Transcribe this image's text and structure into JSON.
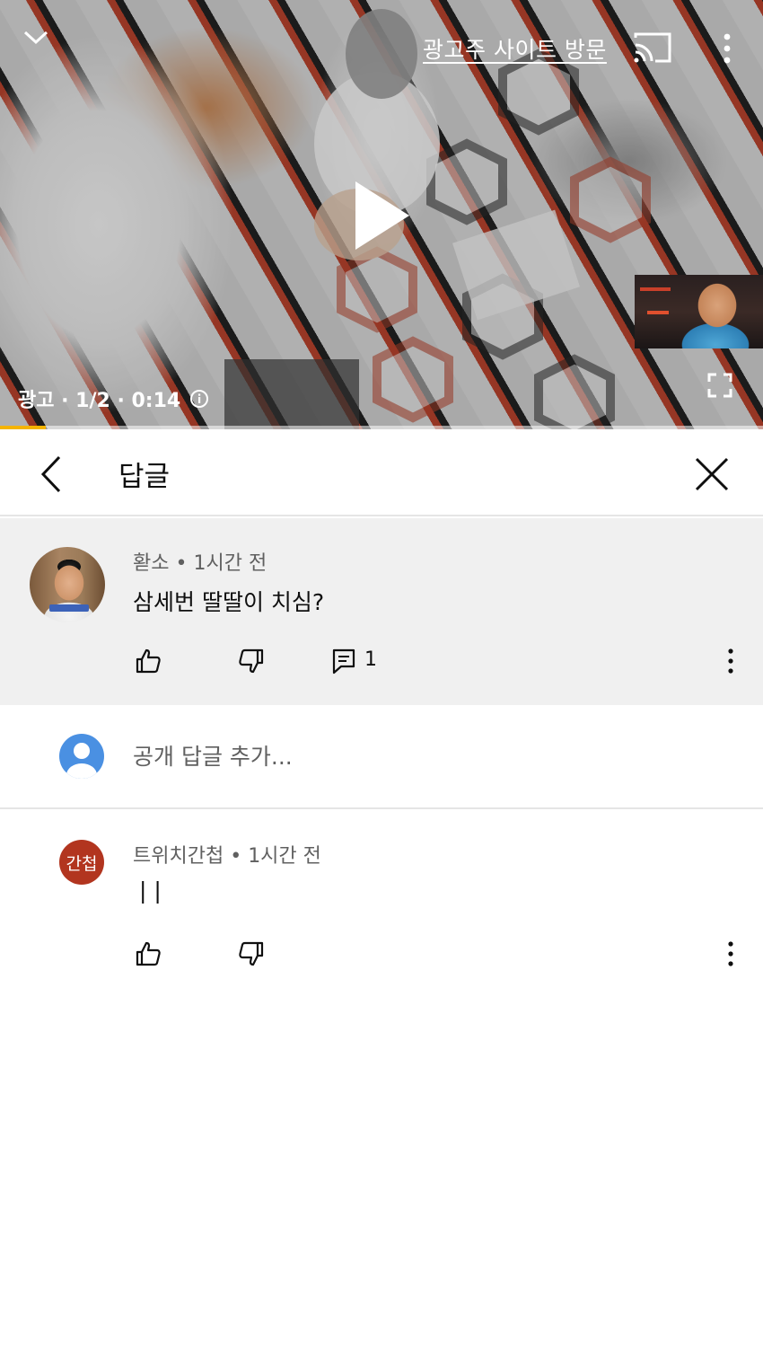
{
  "player": {
    "visit_site_label": "광고주 사이트 방문",
    "ad_info": "광고 · 1/2 · 0:14",
    "progress": 0.06
  },
  "header": {
    "title": "답글"
  },
  "parent_comment": {
    "author": "홛소",
    "time": "1시간 전",
    "text": "삼세번 딸딸이 치심?",
    "reply_count": "1"
  },
  "add_reply": {
    "placeholder": "공개 답글 추가..."
  },
  "reply": {
    "avatar_text": "간첩",
    "author": "트위치간첩",
    "time": "1시간 전",
    "text": "| |"
  },
  "colors": {
    "progress": "#f5b400",
    "parent_bg": "#f0f0f0",
    "reply_avatar_bg": "#b2351f",
    "default_avatar_bg": "#4a90e2"
  },
  "icons": [
    "chevron-down-icon",
    "cast-icon",
    "more-vert-icon",
    "play-icon",
    "info-icon",
    "fullscreen-icon",
    "back-arrow-icon",
    "close-icon",
    "like-icon",
    "dislike-icon",
    "reply-icon"
  ]
}
